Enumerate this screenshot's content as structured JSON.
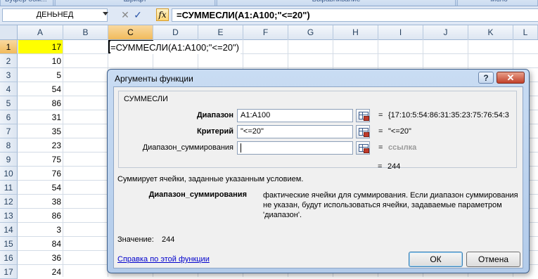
{
  "ribbon": {
    "groups": [
      "Буфер обм...",
      "Шрифт",
      "Выравнивание",
      "Число"
    ]
  },
  "formula_bar": {
    "name_box": "ДЕНЬНЕД",
    "cancel_glyph": "✕",
    "enter_glyph": "✓",
    "fx_label": "fx",
    "formula": "=СУММЕСЛИ(A1:A100;\"<=20\")"
  },
  "grid": {
    "columns": [
      "A",
      "B",
      "C",
      "D",
      "E",
      "F",
      "G",
      "H",
      "I",
      "J",
      "K",
      "L"
    ],
    "rows": [
      "1",
      "2",
      "3",
      "4",
      "5",
      "6",
      "7",
      "8",
      "9",
      "10",
      "11",
      "12",
      "13",
      "14",
      "15",
      "16",
      "17"
    ],
    "column_a_values": [
      "17",
      "10",
      "5",
      "54",
      "86",
      "31",
      "35",
      "23",
      "75",
      "76",
      "54",
      "38",
      "86",
      "3",
      "84",
      "36",
      "24"
    ],
    "c1_text": "=СУММЕСЛИ(A1:A100;\"<=20\")",
    "highlight_color": "#ffff00"
  },
  "dialog": {
    "title": "Аргументы функции",
    "help_glyph": "?",
    "close_glyph": "✕",
    "function_name": "СУММЕСЛИ",
    "args": [
      {
        "label": "Диапазон",
        "value": "A1:A100",
        "eq": "=",
        "result": "{17:10:5:54:86:31:35:23:75:76:54:3"
      },
      {
        "label": "Критерий",
        "value": "\"<=20\"",
        "eq": "=",
        "result": "\"<=20\""
      },
      {
        "label": "Диапазон_суммирования",
        "value": "",
        "eq": "=",
        "result": "ссылка"
      }
    ],
    "function_eq": "=",
    "function_result": "244",
    "description": "Суммирует ячейки, заданные указанным условием.",
    "param_label": "Диапазон_суммирования",
    "param_description": "фактические ячейки для суммирования. Если диапазон суммирования не указан, будут использоваться ячейки, задаваемые параметром 'диапазон'.",
    "value_label": "Значение:",
    "value": "244",
    "help_link": "Справка по этой функции",
    "ok_label": "ОК",
    "cancel_label": "Отмена"
  }
}
